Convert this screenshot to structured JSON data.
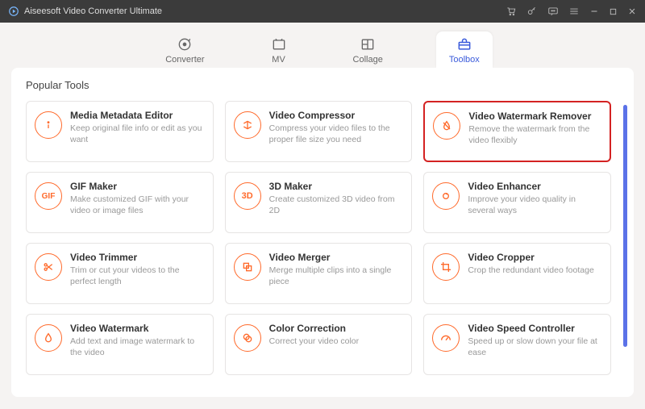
{
  "app": {
    "title": "Aiseesoft Video Converter Ultimate"
  },
  "tabs": [
    {
      "label": "Converter"
    },
    {
      "label": "MV"
    },
    {
      "label": "Collage"
    },
    {
      "label": "Toolbox"
    }
  ],
  "section": {
    "title": "Popular Tools"
  },
  "tools": [
    {
      "title": "Media Metadata Editor",
      "desc": "Keep original file info or edit as you want"
    },
    {
      "title": "Video Compressor",
      "desc": "Compress your video files to the proper file size you need"
    },
    {
      "title": "Video Watermark Remover",
      "desc": "Remove the watermark from the video flexibly"
    },
    {
      "title": "GIF Maker",
      "desc": "Make customized GIF with your video or image files"
    },
    {
      "title": "3D Maker",
      "desc": "Create customized 3D video from 2D"
    },
    {
      "title": "Video Enhancer",
      "desc": "Improve your video quality in several ways"
    },
    {
      "title": "Video Trimmer",
      "desc": "Trim or cut your videos to the perfect length"
    },
    {
      "title": "Video Merger",
      "desc": "Merge multiple clips into a single piece"
    },
    {
      "title": "Video Cropper",
      "desc": "Crop the redundant video footage"
    },
    {
      "title": "Video Watermark",
      "desc": "Add text and image watermark to the video"
    },
    {
      "title": "Color Correction",
      "desc": "Correct your video color"
    },
    {
      "title": "Video Speed Controller",
      "desc": "Speed up or slow down your file at ease"
    }
  ]
}
